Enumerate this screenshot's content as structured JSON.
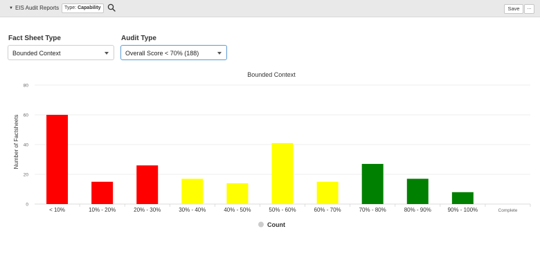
{
  "topbar": {
    "report_title": "EIS Audit Reports",
    "type_label": "Type:",
    "type_value": "Capability",
    "save_label": "Save",
    "more_label": "..."
  },
  "filters": {
    "fact_sheet_type": {
      "label": "Fact Sheet Type",
      "value": "Bounded Context"
    },
    "audit_type": {
      "label": "Audit Type",
      "value": "Overall Score < 70% (188)"
    }
  },
  "colors": {
    "red": "#ff0000",
    "yellow": "#ffff00",
    "green": "#008000",
    "legend_dot": "#cccccc"
  },
  "chart_data": {
    "type": "bar",
    "title": "Bounded Context",
    "ylabel": "Number of Factsheets",
    "xlabel": "",
    "ylim": [
      0,
      80
    ],
    "yticks": [
      0,
      20,
      40,
      60,
      80
    ],
    "categories": [
      "< 10%",
      "10% - 20%",
      "20% - 30%",
      "30% - 40%",
      "40% - 50%",
      "50% - 60%",
      "60% - 70%",
      "70% - 80%",
      "80% - 90%",
      "90% - 100%",
      "Complete"
    ],
    "series": [
      {
        "name": "Count",
        "values": [
          60,
          15,
          26,
          17,
          14,
          41,
          15,
          27,
          17,
          8,
          0
        ],
        "colors": [
          "red",
          "red",
          "red",
          "yellow",
          "yellow",
          "yellow",
          "yellow",
          "green",
          "green",
          "green",
          "green"
        ]
      }
    ],
    "legend": "bottom-center",
    "grid": true
  }
}
